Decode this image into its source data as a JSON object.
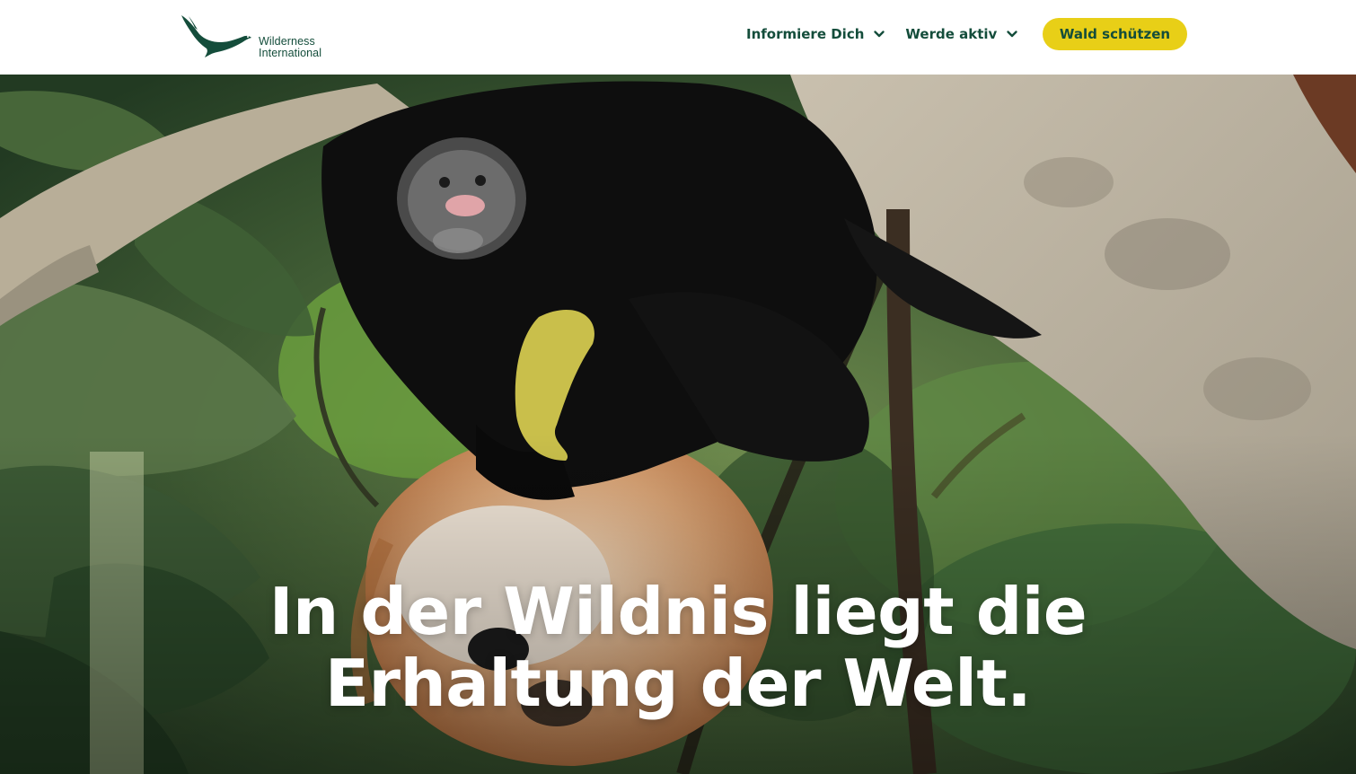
{
  "brand": {
    "name_line1": "Wilderness",
    "name_line2": "International",
    "color": "#144d3b"
  },
  "nav": {
    "items": [
      {
        "label": "Informiere Dich",
        "icon": "chevron-down-icon"
      },
      {
        "label": "Werde aktiv",
        "icon": "chevron-down-icon"
      }
    ],
    "cta_label": "Wald schützen",
    "cta_color": "#e8cf17"
  },
  "hero": {
    "title_line1": "In der Wildnis liegt die",
    "title_line2": "Erhaltung der Welt.",
    "image": "tamarin-monkeys-in-rainforest-canopy"
  }
}
